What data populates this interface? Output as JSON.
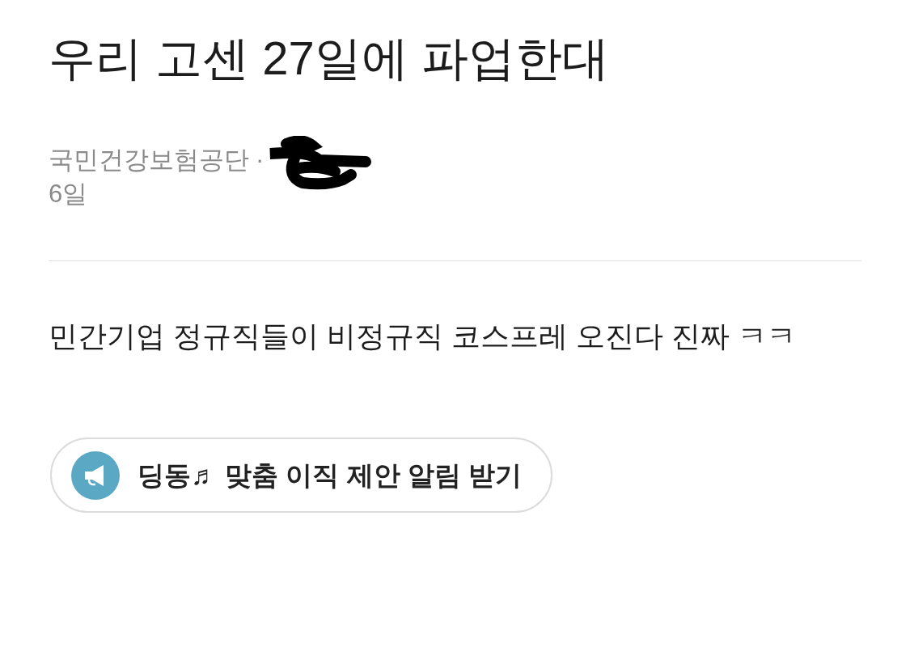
{
  "post": {
    "title": "우리 고센 27일에 파업한대",
    "company": "국민건강보험공단",
    "separator": "·",
    "date": "6일",
    "body": "민간기업 정규직들이 비정규직 코스프레 오진다 진짜 ㅋㅋ"
  },
  "alert_button": {
    "label": "딩동♬ 맞춤 이직 제안 알림 받기"
  }
}
